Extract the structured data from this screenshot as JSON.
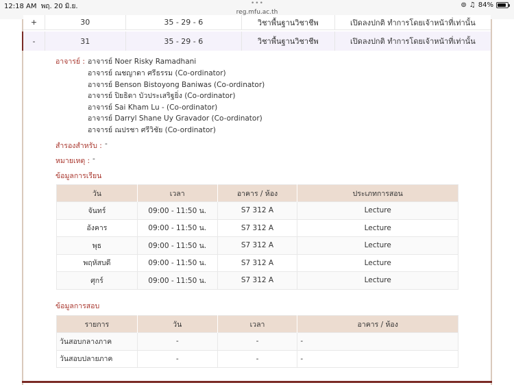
{
  "status_bar": {
    "time": "12:18 AM",
    "date": "พฤ. 20 มิ.ย.",
    "url": "reg.mfu.ac.th",
    "battery": "84%",
    "battery_level": 0.84
  },
  "sections": [
    {
      "toggle": "+",
      "section": "30",
      "hours": "35 - 29 - 6",
      "category": "วิชาพื้นฐานวิชาชีพ",
      "status": "เปิดลงปกติ ทำการโดยเจ้าหน้าที่เท่านั้น"
    },
    {
      "toggle": "-",
      "section": "31",
      "hours": "35 - 29 - 6",
      "category": "วิชาพื้นฐานวิชาชีพ",
      "status": "เปิดลงปกติ ทำการโดยเจ้าหน้าที่เท่านั้น"
    }
  ],
  "detail": {
    "instructor_label": "อาจารย์ :",
    "instructors": [
      "อาจารย์ Noer Risky Ramadhani",
      "อาจารย์ ณชญาดา ศรีธรรม (Co-ordinator)",
      "อาจารย์ Benson Bistoyong Baniwas (Co-ordinator)",
      "อาจารย์ ปิยธิดา บัวประเสริฐยิ่ง (Co-ordinator)",
      "อาจารย์ Sai Kham Lu - (Co-ordinator)",
      "อาจารย์ Darryl Shane Uy Gravador (Co-ordinator)",
      "อาจารย์ ณปรชา ศรีวิชัย (Co-ordinator)"
    ],
    "reserved_label": "สำรองสำหรับ :",
    "reserved_value": "-",
    "remark_label": "หมายเหตุ :",
    "remark_value": "-",
    "study_title": "ข้อมูลการเรียน",
    "study_headers": [
      "วัน",
      "เวลา",
      "อาคาร / ห้อง",
      "ประเภทการสอน"
    ],
    "study_rows": [
      [
        "จันทร์",
        "09:00 - 11:50 น.",
        "S7 312 A",
        "Lecture"
      ],
      [
        "อังคาร",
        "09:00 - 11:50 น.",
        "S7 312 A",
        "Lecture"
      ],
      [
        "พุธ",
        "09:00 - 11:50 น.",
        "S7 312 A",
        "Lecture"
      ],
      [
        "พฤหัสบดี",
        "09:00 - 11:50 น.",
        "S7 312 A",
        "Lecture"
      ],
      [
        "ศุกร์",
        "09:00 - 11:50 น.",
        "S7 312 A",
        "Lecture"
      ]
    ],
    "exam_title": "ข้อมูลการสอบ",
    "exam_headers": [
      "รายการ",
      "วัน",
      "เวลา",
      "อาคาร / ห้อง"
    ],
    "exam_rows": [
      [
        "วันสอบกลางภาค",
        "-",
        "-",
        "-"
      ],
      [
        "วันสอบปลายภาค",
        "-",
        "-",
        "-"
      ]
    ]
  },
  "colors": {
    "accent": "#a8352c",
    "header_bg": "#ecdcd0",
    "bottom_bar": "#7a2a25"
  }
}
